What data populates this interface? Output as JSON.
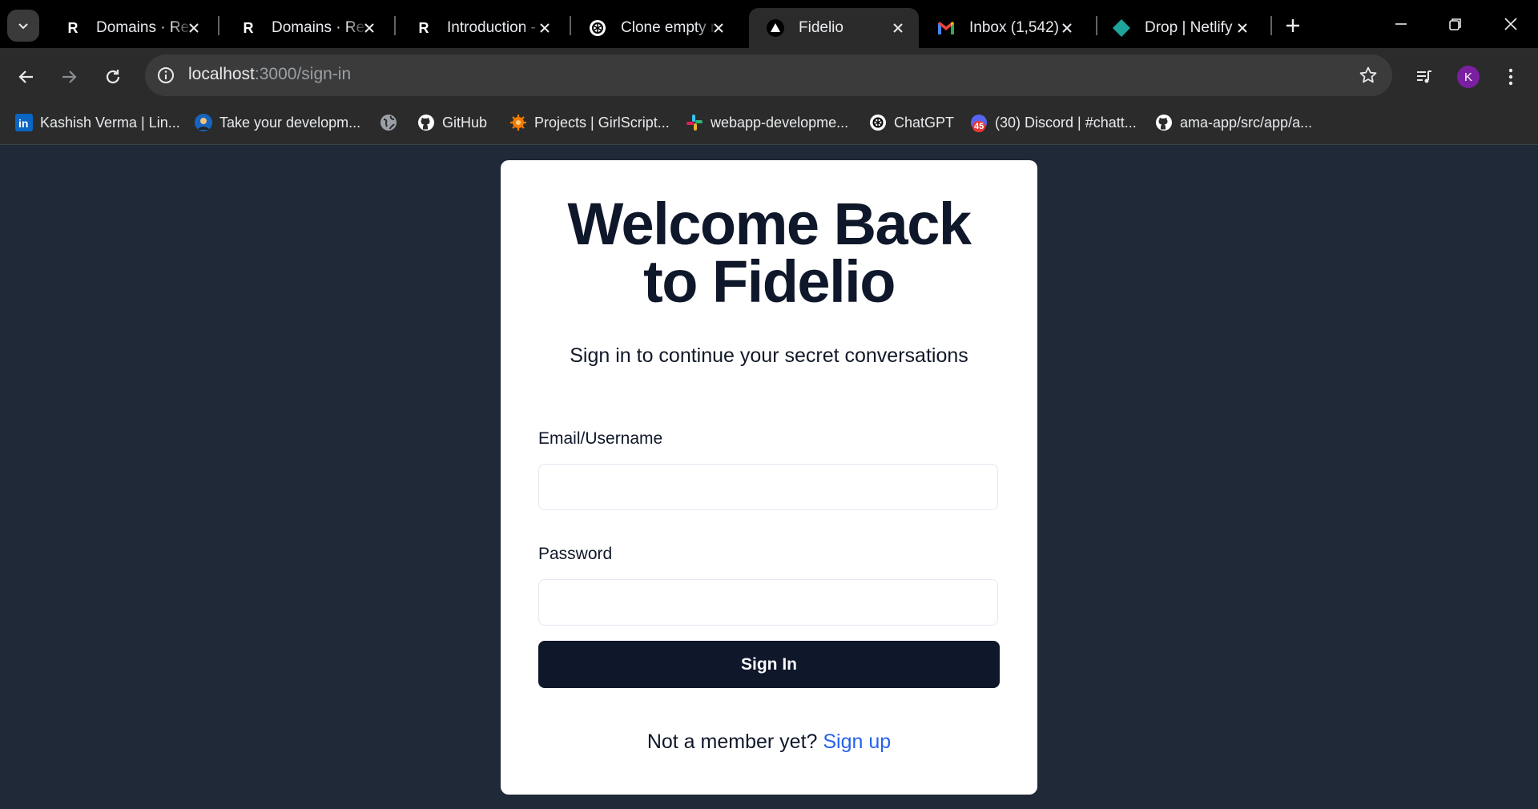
{
  "browser": {
    "tabs": [
      {
        "title": "Domains · Res",
        "icon": "render-icon"
      },
      {
        "title": "Domains · Res",
        "icon": "render-icon"
      },
      {
        "title": "Introduction -",
        "icon": "render-icon"
      },
      {
        "title": "Clone empty r",
        "icon": "openai-icon"
      },
      {
        "title": "Fidelio",
        "icon": "nextjs-triangle-icon",
        "active": true
      },
      {
        "title": "Inbox (1,542)",
        "icon": "gmail-icon"
      },
      {
        "title": "Drop | Netlify",
        "icon": "netlify-icon"
      }
    ],
    "url_host": "localhost",
    "url_rest": ":3000/sign-in",
    "profile_initial": "K",
    "bookmarks": [
      {
        "label": "Kashish Verma | Lin...",
        "icon": "linkedin-icon"
      },
      {
        "label": "Take your developm...",
        "icon": "profile-photo-icon"
      },
      {
        "label": "",
        "icon": "globe-icon"
      },
      {
        "label": "GitHub",
        "icon": "github-icon"
      },
      {
        "label": "Projects | GirlScript...",
        "icon": "girlscript-icon"
      },
      {
        "label": "webapp-developme...",
        "icon": "slack-icon"
      },
      {
        "label": "ChatGPT",
        "icon": "openai-icon"
      },
      {
        "label": "(30) Discord | #chatt...",
        "icon": "discord-icon"
      },
      {
        "label": "ama-app/src/app/a...",
        "icon": "github-icon"
      }
    ],
    "bookmark_badge": "45"
  },
  "signin": {
    "title_line1": "Welcome Back",
    "title_line2": "to Fidelio",
    "subtitle": "Sign in to continue your secret conversations",
    "email_label": "Email/Username",
    "email_value": "",
    "password_label": "Password",
    "password_value": "",
    "submit_label": "Sign In",
    "footer_text": "Not a member yet?",
    "signup_link": "Sign up"
  },
  "colors": {
    "page_bg": "#1f2937",
    "card_bg": "#ffffff",
    "button_bg": "#0f172a",
    "link": "#2563eb",
    "avatar": "#7b1fa2"
  }
}
